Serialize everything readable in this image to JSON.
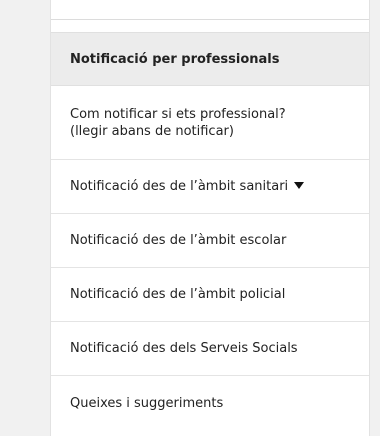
{
  "section": {
    "title": "Notificació per professionals"
  },
  "menu": {
    "items": [
      {
        "lines": [
          "Com notificar si ets professional?",
          "(llegir abans de notificar)"
        ]
      },
      {
        "label": "Notificació des de l’àmbit sanitari",
        "icon": "caret-down-icon"
      },
      {
        "label": "Notificació des de l’àmbit escolar"
      },
      {
        "label": "Notificació des de l’àmbit policial"
      },
      {
        "label": "Notificació des dels Serveis Socials"
      },
      {
        "label": "Queixes i suggeriments"
      }
    ]
  }
}
